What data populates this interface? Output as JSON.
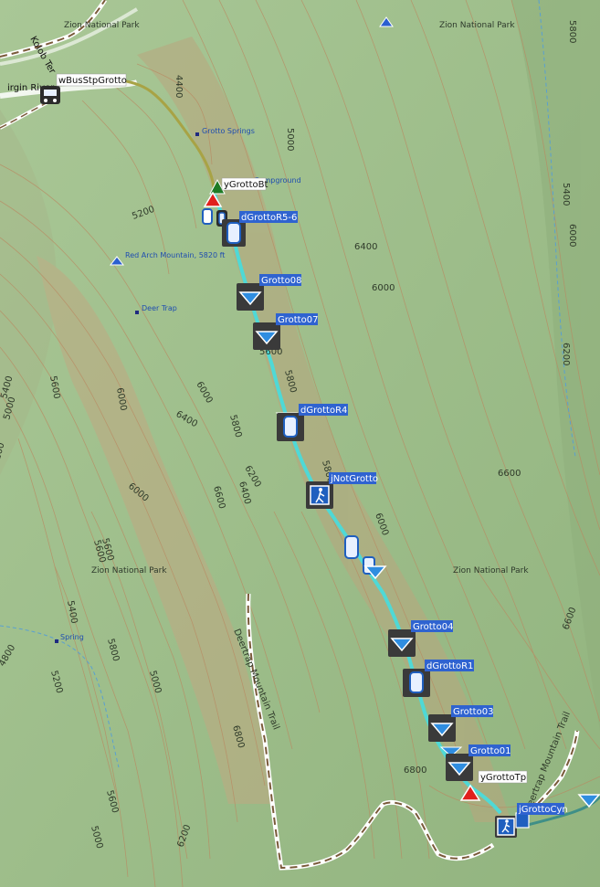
{
  "park_labels": [
    "Zion National Park",
    "Zion National Park",
    "Zion National Park",
    "Zion National Park"
  ],
  "elevation_labels": [
    "5800",
    "5400",
    "6200",
    "4400",
    "5000",
    "5200",
    "6400",
    "6000",
    "5600",
    "5800",
    "6000",
    "5400",
    "5600",
    "6000",
    "6400",
    "5800",
    "6200",
    "6400",
    "6000",
    "6600",
    "6000",
    "6600",
    "5600",
    "5800",
    "6600",
    "5400",
    "4800",
    "5200",
    "5800",
    "5600",
    "5000",
    "6200",
    "6800",
    "6800",
    "5000",
    "5600",
    "5000",
    "6000",
    "5200"
  ],
  "poi_labels": {
    "grotto_springs": "Grotto Springs",
    "campground": "Campground",
    "red_arch": "Red Arch Mountain, 5820 ft",
    "deer_trap": "Deer Trap",
    "spring": "Spring",
    "virgin_river": "irgin River",
    "kolob": "Kolob Ter",
    "deertrap_trail_1": "Deertrap Mountain Trail",
    "deertrap_trail_2": "Deertrap Mountain Trail"
  },
  "waypoints": {
    "bus": "wBusStpGrotto",
    "ybt": "yGrottoBt",
    "r56": "dGrottoR5-6",
    "g08": "Grotto08",
    "g07": "Grotto07",
    "r4": "dGrottoR4",
    "not": "jNotGrotto",
    "g04": "Grotto04",
    "r1": "dGrottoR1",
    "g03": "Grotto03",
    "g01": "Grotto01",
    "ytp": "yGrottoTp",
    "cyn": "jGrottoCyn"
  },
  "colors": {
    "terrain": "#9fbf8c",
    "contour": "#b98a62",
    "route": "#4fd9d6",
    "label_bg": "#2f63d0",
    "trail": "#7a5a3a",
    "stream": "#5aa0d0"
  }
}
